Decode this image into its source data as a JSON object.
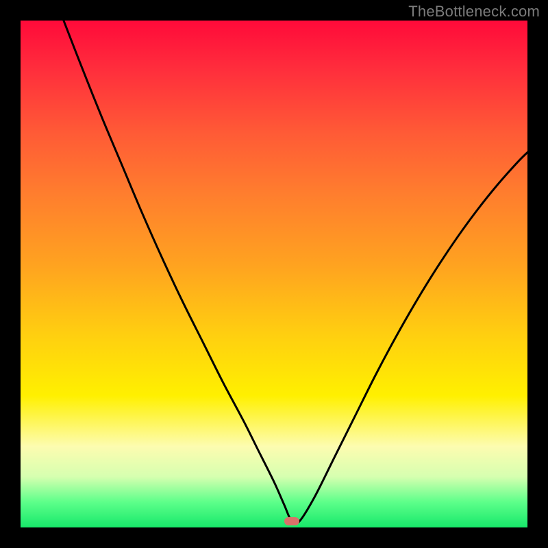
{
  "watermark": "TheBottleneck.com",
  "marker": {
    "x_pct": 53.5,
    "y_pct": 99.0,
    "color": "#d9726a"
  },
  "chart_data": {
    "type": "line",
    "title": "",
    "xlabel": "",
    "ylabel": "",
    "xlim": [
      0,
      100
    ],
    "ylim": [
      0,
      100
    ],
    "grid": false,
    "legend": false,
    "note": "Single V-shaped curve; values are estimated from pixels (no axis ticks present). y is percentage height from bottom (0) to top (100).",
    "series": [
      {
        "name": "curve",
        "x": [
          8.5,
          12,
          16,
          20,
          24,
          28,
          32,
          36,
          40,
          44,
          47,
          50,
          52,
          53.5,
          55,
          58,
          62,
          66,
          70,
          74,
          78,
          82,
          86,
          90,
          94,
          98,
          100
        ],
        "y": [
          100,
          91,
          81,
          71.5,
          62,
          53,
          44.5,
          36.5,
          28.5,
          21,
          15,
          9,
          4.5,
          1.2,
          1.2,
          6,
          14,
          22,
          30,
          37.5,
          44.5,
          51,
          57,
          62.5,
          67.5,
          72,
          74
        ]
      }
    ],
    "gradient_stops": [
      {
        "pos": 0.0,
        "color": "#ff0a3a"
      },
      {
        "pos": 0.1,
        "color": "#ff2f3c"
      },
      {
        "pos": 0.22,
        "color": "#ff5a36"
      },
      {
        "pos": 0.34,
        "color": "#ff7d2e"
      },
      {
        "pos": 0.48,
        "color": "#ffa220"
      },
      {
        "pos": 0.62,
        "color": "#ffcf10"
      },
      {
        "pos": 0.74,
        "color": "#fff000"
      },
      {
        "pos": 0.84,
        "color": "#fdfcb0"
      },
      {
        "pos": 0.9,
        "color": "#d6ffb0"
      },
      {
        "pos": 0.95,
        "color": "#5dff8a"
      },
      {
        "pos": 1.0,
        "color": "#17e86a"
      }
    ]
  }
}
